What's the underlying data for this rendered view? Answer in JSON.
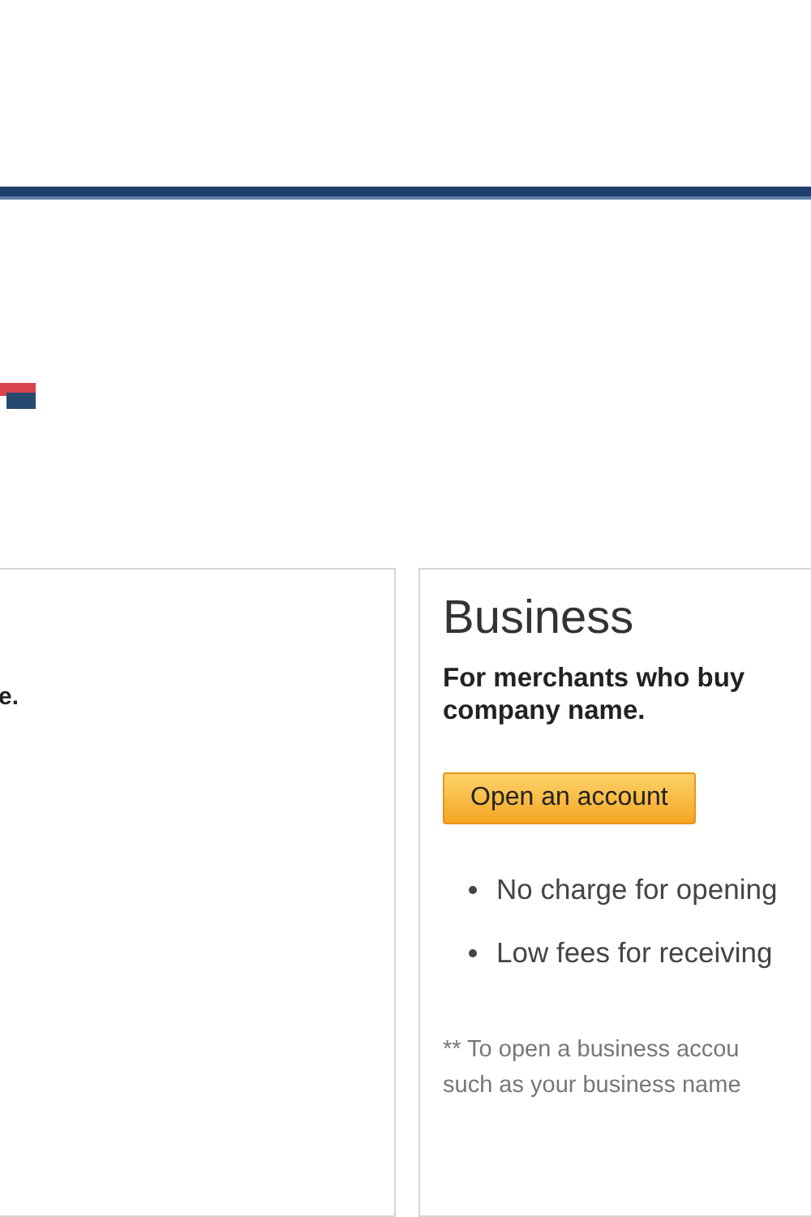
{
  "personal_card": {
    "text": "e."
  },
  "business_card": {
    "title": "Business",
    "description": "For merchants who buy",
    "description_2": "company name.",
    "button": "Open an account",
    "bullets": [
      "No charge for opening",
      "Low fees for receiving"
    ],
    "footnote": [
      "** To open a business accou",
      "such as your business name"
    ]
  }
}
